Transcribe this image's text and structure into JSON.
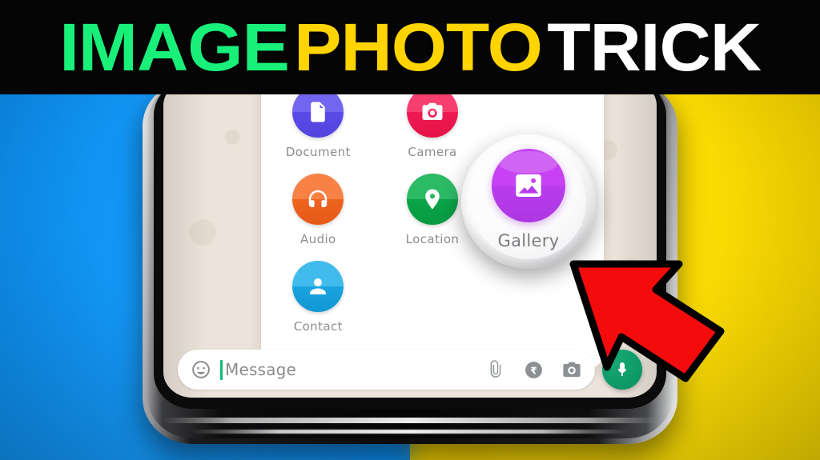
{
  "banner": {
    "words": [
      {
        "text": "IMAGE",
        "color": "#18f07a"
      },
      {
        "text": "PHOTO",
        "color": "#ffd400"
      },
      {
        "text": "TRICK",
        "color": "#ffffff"
      }
    ],
    "background": "#050505"
  },
  "background": {
    "left_color": "#0b8ff0",
    "right_color": "#f5d400"
  },
  "phone": {
    "frame_color": "#0b0b0c",
    "screen_background": "#ece4da"
  },
  "attachment_panel": {
    "background": "#ffffff",
    "items": [
      {
        "label": "Document",
        "icon": "document-icon",
        "color": "#5b4be8"
      },
      {
        "label": "Camera",
        "icon": "camera-icon",
        "color": "#f01c55"
      },
      {
        "label": "Audio",
        "icon": "headphones-icon",
        "color": "#f26722"
      },
      {
        "label": "Location",
        "icon": "location-pin-icon",
        "color": "#0fa84b"
      },
      {
        "label": "Contact",
        "icon": "person-icon",
        "color": "#1fa6e0"
      }
    ]
  },
  "gallery_bubble": {
    "label": "Gallery",
    "icon": "image-icon",
    "color": "#c642f2",
    "bubble_color": "#f2f2f4"
  },
  "message_bar": {
    "emoji_icon": "smiley-icon",
    "placeholder": "Message",
    "cursor_color": "#12b878",
    "attach_icon": "paperclip-icon",
    "payment_icon": "rupee-icon",
    "camera_icon": "camera-icon",
    "mic_icon": "microphone-icon",
    "mic_button_color": "#0d9c6a"
  },
  "annotation": {
    "arrow": "red-arrow-pointing-up-left",
    "fill": "#f40c0c",
    "stroke": "#000000"
  }
}
